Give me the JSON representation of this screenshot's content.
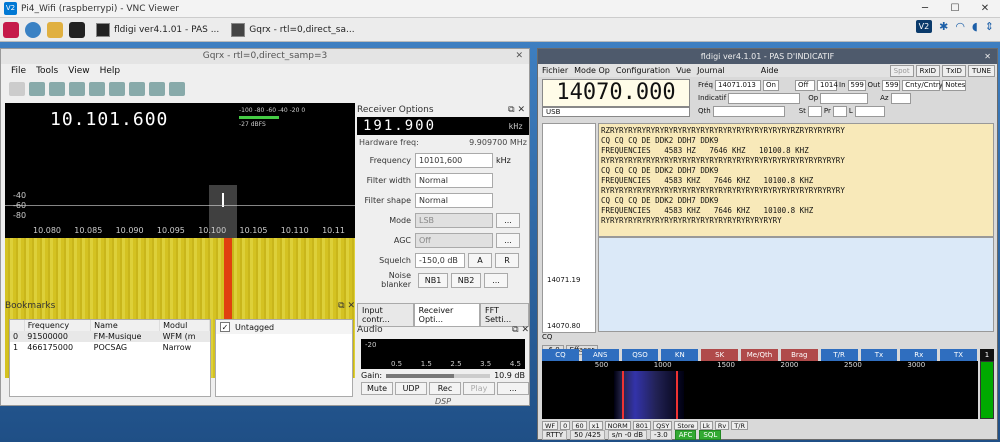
{
  "vnc": {
    "title": "Pi4_Wifi (raspberrypi) - VNC Viewer",
    "logo": "V2"
  },
  "taskbar": {
    "fldigi": "fldigi ver4.1.01 - PAS ...",
    "gqrx": "Gqrx - rtl=0,direct_sa...",
    "vnc_badge": "V2"
  },
  "gqrx": {
    "title": "Gqrx - rtl=0,direct_samp=3",
    "menu": [
      "File",
      "Tools",
      "View",
      "Help"
    ],
    "freq": "10.101.600",
    "db_ticks": "-100 -80 -60 -40 -20 0",
    "dbfs": "-27 dBFS",
    "y_ticks": [
      "-40",
      "-60",
      "-80"
    ],
    "x_ticks": [
      "10.080",
      "10.085",
      "10.090",
      "10.095",
      "10.100",
      "10.105",
      "10.110",
      "10.11"
    ],
    "receiver": {
      "header": "Receiver Options",
      "lcd": "191.900",
      "lcd_unit": "kHz",
      "hw_label": "Hardware freq:",
      "hw_value": "9.909700 MHz",
      "freq_label": "Frequency",
      "freq_value": "10101,600",
      "freq_unit": "kHz",
      "fw_label": "Filter width",
      "fw_value": "Normal",
      "fs_label": "Filter shape",
      "fs_value": "Normal",
      "mode_label": "Mode",
      "mode_value": "LSB",
      "agc_label": "AGC",
      "agc_value": "Off",
      "sq_label": "Squelch",
      "sq_value": "-150,0 dB",
      "sq_a": "A",
      "sq_r": "R",
      "nb_label": "Noise blanker",
      "nb1": "NB1",
      "nb2": "NB2",
      "dots": "..."
    },
    "tabs": [
      "Input contr...",
      "Receiver Opti...",
      "FFT Setti..."
    ],
    "bookmarks": {
      "header": "Bookmarks",
      "cols": [
        "Frequency",
        "Name",
        "Modul"
      ],
      "rows": [
        {
          "i": "0",
          "f": "91500000",
          "n": "FM-Musique",
          "m": "WFM (m"
        },
        {
          "i": "1",
          "f": "466175000",
          "n": "POCSAG",
          "m": "Narrow"
        }
      ],
      "tag": "Untagged"
    },
    "audio": {
      "header": "Audio",
      "ytick": "-20",
      "xticks": [
        "0.5",
        "1.5",
        "2.5",
        "3.5",
        "4.5"
      ],
      "gain_label": "Gain:",
      "gain_value": "10.9 dB",
      "buttons": [
        "Mute",
        "UDP",
        "Rec",
        "Play",
        "..."
      ],
      "dsp": "DSP"
    }
  },
  "fldigi": {
    "title": "fldigi ver4.1.01 - PAS D'INDICATIF",
    "menu": [
      "Fichier",
      "Mode Op",
      "Configuration",
      "Vue",
      "Journal",
      "Aide"
    ],
    "toggles": [
      "Spot",
      "RxID",
      "TxID",
      "TUNE"
    ],
    "freq": "14070.000",
    "mode": "USB",
    "frq_label": "Fréq",
    "frq_value": "14071.013",
    "on_label": "On",
    "off_label": "Off",
    "off_value": "1014",
    "in_label": "In",
    "in_value": "599",
    "out_label": "Out",
    "out_value": "599",
    "cnty": "Cnty/Cntry",
    "notes": "Notes",
    "ind_label": "Indicatif",
    "op_label": "Op",
    "az_label": "Az",
    "qth_label": "Qth",
    "st_label": "St",
    "pr_label": "Pr",
    "l_label": "L",
    "rx_text": "RZRYRYRYRYRYRYRYRYRYRYRYRYRYRYRYRYRYRYRYRYRZRYRYRYRYRY\nCQ CQ CQ DE DDK2 DDH7 DDK9\nFREQUENCIES   4583 HZ   7646 KHZ   10100.8 KHZ\nRYRYRYRYRYRYRYRYRYRYRYRYRYRYRYRYRYRYRYRYRYRYRYRYRYRYRY\nCQ CQ CQ DE DDK2 DDH7 DDK9\nFREQUENCIES   4583 KHZ   7646 KHZ   10100.8 KHZ\nRYRYRYRYRYRYRYRYRYRYRYRYRYRYRYRYRYRYRYRYRYRYRYRYRYRYRY\nCQ CQ CQ DE DDK2 DDH7 DDK9\nFREQUENCIES   4583 KHZ   7646 KHZ   10100.8 KHZ\nRYRYRYRYRYRYRYRYRYRYRYRYRYRYRYRYRYRYRYRY",
    "scope_a": "14071.19",
    "scope_b": "14070.80",
    "cq": "CQ",
    "level": "-6.0",
    "clear": "Effacer",
    "macros": [
      "CQ",
      "ANS",
      "QSO",
      "KN",
      "SK",
      "Me/Qth",
      "Brag",
      "T/R",
      "Tx",
      "Rx",
      "TX",
      "1"
    ],
    "wf_ticks": [
      "500",
      "1000",
      "1500",
      "2000",
      "2500",
      "3000"
    ],
    "bottom": [
      "WF",
      "0",
      "60",
      "x1",
      "NORM",
      "801",
      "QSY",
      "Store",
      "Lk",
      "Rv",
      "T/R"
    ],
    "status": [
      "RTTY",
      "50 /425",
      "s/n -0  dB",
      "-3.0",
      "AFC",
      "SQL"
    ]
  }
}
